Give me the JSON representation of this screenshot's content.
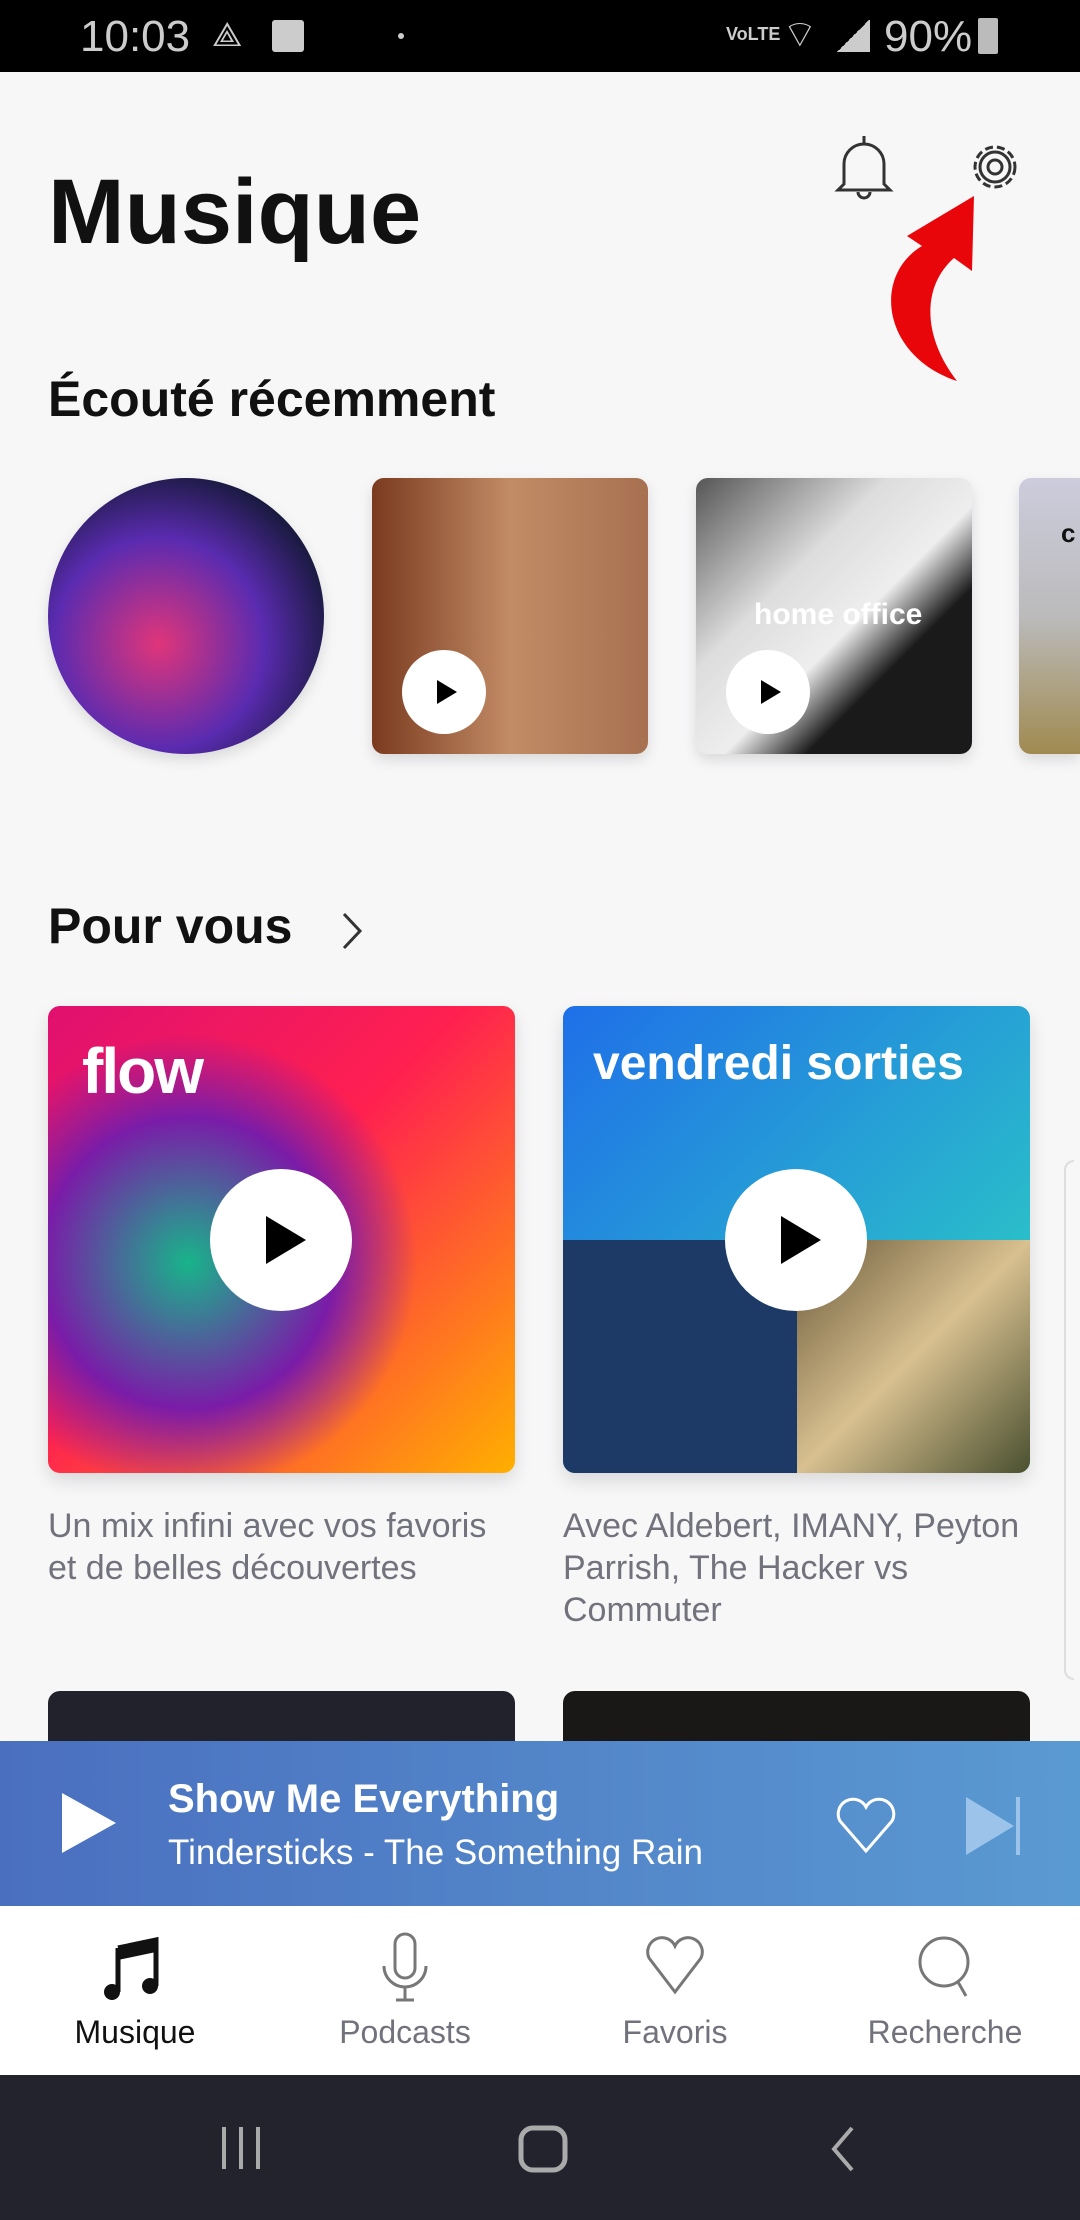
{
  "status_bar": {
    "time": "10:03",
    "network": "VoLTE",
    "battery": "90%"
  },
  "header": {
    "title": "Musique",
    "icons": [
      "bell-icon",
      "gear-icon"
    ],
    "annotation": "red-arrow pointing to settings"
  },
  "recent": {
    "title": "Écouté récemment",
    "items": [
      {
        "type": "artist"
      },
      {
        "type": "album"
      },
      {
        "type": "playlist",
        "label": "home office"
      },
      {
        "type": "playlist",
        "label": "c"
      }
    ]
  },
  "for_you": {
    "title": "Pour vous",
    "cards": [
      {
        "title": "flow",
        "description": "Un mix infini avec vos favoris et de belles découvertes"
      },
      {
        "title": "vendredi sorties",
        "description": "Avec Aldebert, IMANY, Peyton Parrish, The Hacker vs Commuter"
      }
    ]
  },
  "player": {
    "title": "Show Me Everything",
    "subtitle": "Tindersticks - The Something Rain",
    "gradient": [
      "#4a6fbf",
      "#5a9ad2"
    ]
  },
  "nav": {
    "items": [
      {
        "label": "Musique",
        "icon": "music-note-icon",
        "active": true
      },
      {
        "label": "Podcasts",
        "icon": "microphone-icon"
      },
      {
        "label": "Favoris",
        "icon": "heart-icon"
      },
      {
        "label": "Recherche",
        "icon": "search-icon"
      }
    ]
  }
}
